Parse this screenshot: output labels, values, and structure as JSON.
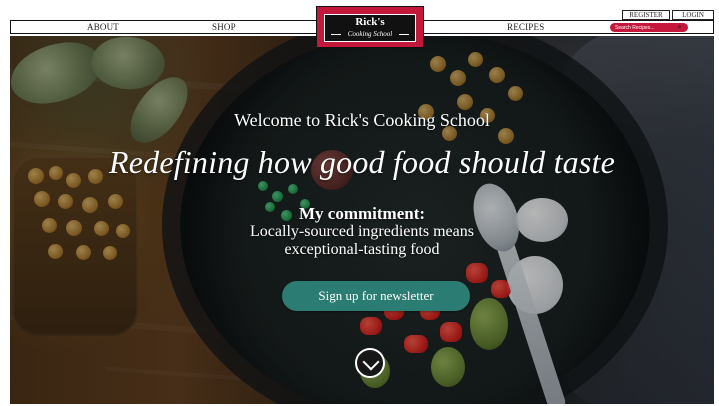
{
  "site": {
    "logo_title": "Rick's",
    "logo_subtitle": "Cooking School"
  },
  "navigation": {
    "items": [
      "ABOUT",
      "SHOP",
      "RECIPES"
    ]
  },
  "auth": {
    "register_label": "REGISTER",
    "login_label": "LOGIN"
  },
  "search": {
    "placeholder": "Search Recipes...",
    "icon": "search-icon"
  },
  "hero": {
    "welcome": "Welcome to Rick's Cooking School",
    "headline": "Redefining how good food should taste",
    "commitment_title": "My commitment:",
    "commitment_line_1": "Locally-sourced ingredients means",
    "commitment_line_2": "exceptional-tasting food",
    "newsletter_button": "Sign up for newsletter",
    "scroll_icon": "chevron-down-icon"
  },
  "colors": {
    "brand_red": "#c3183b",
    "newsletter_teal": "#2b7d74",
    "text_white": "#ffffff"
  }
}
